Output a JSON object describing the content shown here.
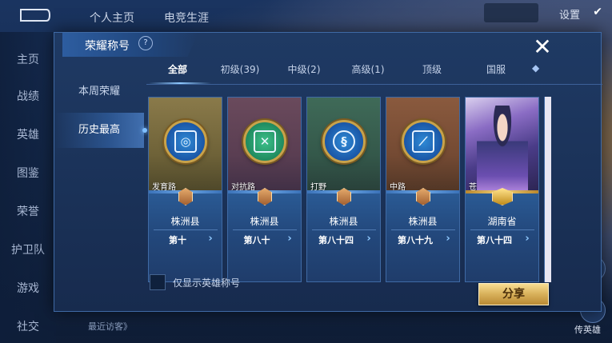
{
  "background": {
    "tabs": [
      "个人主页",
      "电竞生涯"
    ],
    "settings_label": "设置",
    "left_menu": [
      "主页",
      "战绩",
      "英雄",
      "图鉴",
      "荣誉",
      "护卫队",
      "游戏",
      "社交"
    ],
    "recent_visitors": "最近访客》",
    "right_label": "传英雄"
  },
  "dialog": {
    "title": "荣耀称号",
    "help": "?",
    "close": "✕",
    "side_tabs": [
      "本周荣耀",
      "历史最高"
    ],
    "active_side_tab": 1,
    "tabs": [
      "全部",
      "初级(39)",
      "中级(2)",
      "高级(1)",
      "顶级",
      "国服"
    ],
    "active_tab": 0,
    "tab_more": "◆",
    "cards": [
      {
        "role": "发育路",
        "region": "株洲县",
        "place": "第十",
        "icon": "shield-icon"
      },
      {
        "role": "对抗路",
        "region": "株洲县",
        "place": "第八十",
        "icon": "crossed-swords-icon"
      },
      {
        "role": "打野",
        "region": "株洲县",
        "place": "第八十四",
        "icon": "dragon-icon"
      },
      {
        "role": "中路",
        "region": "株洲县",
        "place": "第八十九",
        "icon": "wand-icon"
      },
      {
        "role": "苍",
        "region": "湖南省",
        "place": "第八十四",
        "icon": "hero-portrait"
      }
    ],
    "checkbox_label": "仅显示英雄称号",
    "share_button": "分享"
  }
}
